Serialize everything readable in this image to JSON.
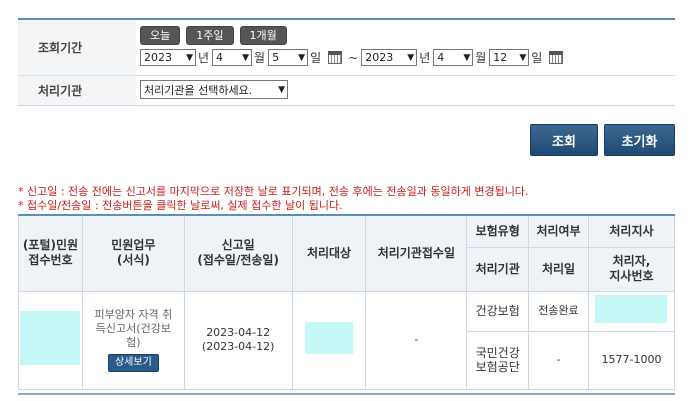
{
  "search": {
    "period_label": "조회기간",
    "quick": [
      "오늘",
      "1주일",
      "1개월"
    ],
    "from": {
      "year": "2023",
      "month": "4",
      "day": "5"
    },
    "to": {
      "year": "2023",
      "month": "4",
      "day": "12"
    },
    "units": {
      "year": "년",
      "month": "월",
      "day": "일"
    },
    "range_sep": "~",
    "org_label": "처리기관",
    "org_value": "처리기관을 선택하세요."
  },
  "buttons": {
    "search": "조회",
    "reset": "초기화"
  },
  "notes": [
    "* 신고일 : 전송 전에는 신고서를 마지막으로 저장한 날로 표기되며, 전송 후에는 전송일과 동일하게 변경됩니다.",
    "* 접수일/전송일 : 전송버튼을 클릭한 날로써, 실제 접수한 날이 됩니다."
  ],
  "table": {
    "headers": {
      "receipt_no": "(포털)민원\n접수번호",
      "task": "민원업무\n(서식)",
      "report_date": "신고일\n(접수일/전송일)",
      "target": "처리대상",
      "org_receipt_no": "처리기관접수일",
      "insurance_type": "보험유형",
      "status": "처리여부",
      "branch": "처리지사",
      "org": "처리기관",
      "process_date": "처리일",
      "processor": "처리자,\n지사번호"
    },
    "row": {
      "task": "피부양자 자격 취\n득신고서(건강보\n험)",
      "detail": "상세보기",
      "report_date": "2023-04-12\n(2023-04-12)",
      "org_receipt_no": "-",
      "sub": [
        {
          "insurance_type": "건강보험",
          "status": "전송완료"
        },
        {
          "insurance_type": "국민건강\n보험공단",
          "status": "-",
          "processor": "1577-1000"
        }
      ]
    }
  }
}
